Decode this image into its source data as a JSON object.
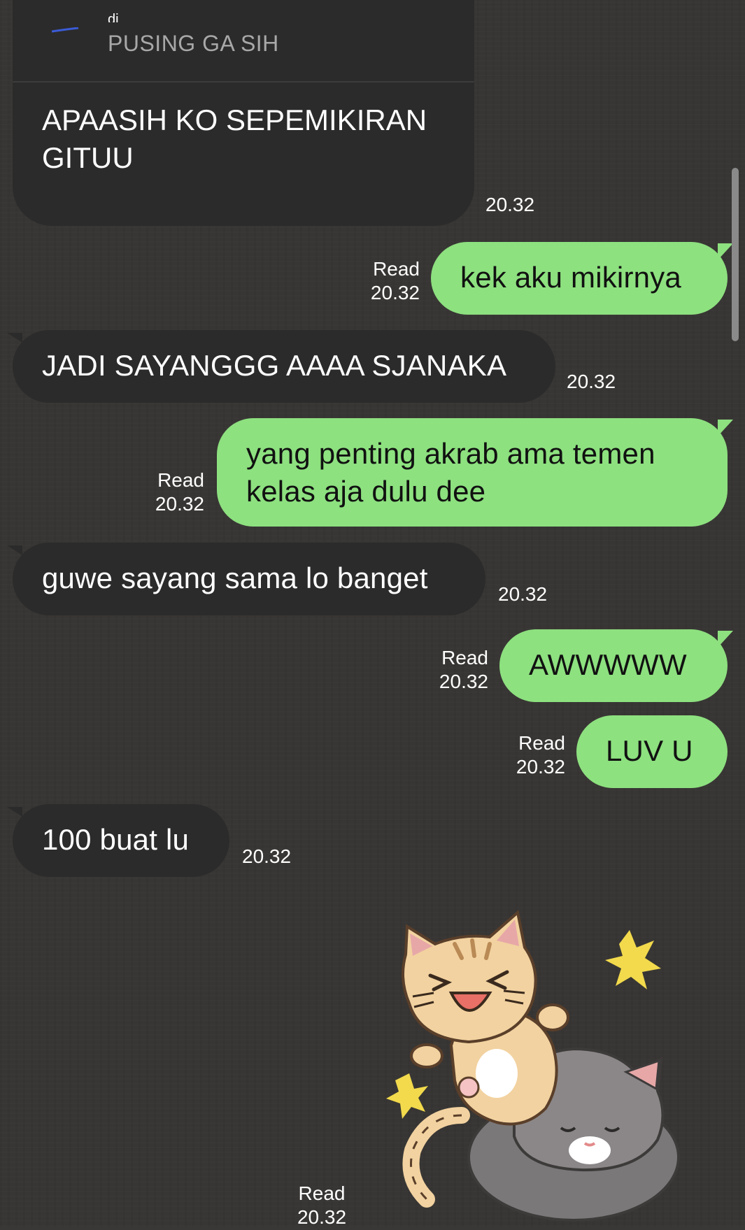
{
  "reply": {
    "sender_name": "di",
    "quoted_text": "PUSING GA SIH",
    "message": "APAASIH KO SEPEMIKIRAN GITUU",
    "time": "20.32"
  },
  "messages": [
    {
      "direction": "out",
      "text": "kek aku mikirnya",
      "status": "Read",
      "time": "20.32"
    },
    {
      "direction": "in",
      "text": "JADI SAYANGGG AAAA SJANAKA",
      "time": "20.32"
    },
    {
      "direction": "out",
      "text": "yang penting akrab ama temen kelas aja dulu dee",
      "status": "Read",
      "time": "20.32"
    },
    {
      "direction": "in",
      "text": "guwe sayang sama lo banget",
      "time": "20.32"
    },
    {
      "direction": "out",
      "text": "AWWWWW",
      "status": "Read",
      "time": "20.32"
    },
    {
      "direction": "out",
      "text": "LUV U",
      "status": "Read",
      "time": "20.32"
    },
    {
      "direction": "in",
      "text": "100 buat lu",
      "time": "20.32"
    }
  ],
  "sticker": {
    "icon": "cat-sticker-icon",
    "status": "Read",
    "time": "20.32"
  },
  "colors": {
    "background": "#383634",
    "incoming_bubble": "#2b2b2b",
    "outgoing_bubble": "#8de17f"
  }
}
